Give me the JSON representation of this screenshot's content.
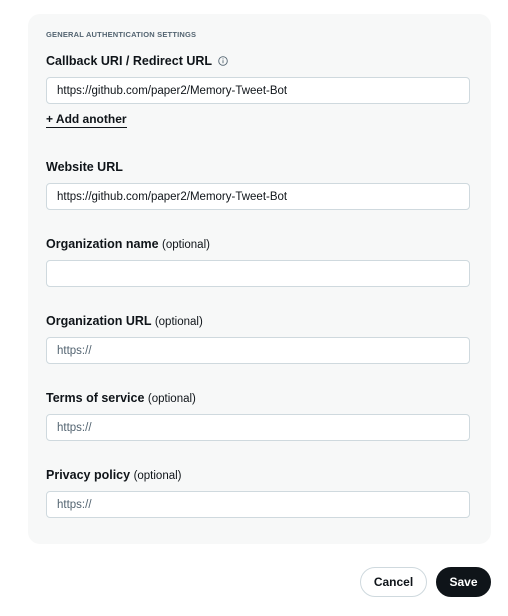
{
  "section": {
    "title": "GENERAL AUTHENTICATION SETTINGS"
  },
  "callback": {
    "label": "Callback URI / Redirect URL",
    "info_icon": "info-circle-icon",
    "value": "https://github.com/paper2/Memory-Tweet-Bot",
    "add_another": "+ Add another"
  },
  "website": {
    "label": "Website URL",
    "value": "https://github.com/paper2/Memory-Tweet-Bot"
  },
  "org_name": {
    "label": "Organization name",
    "optional": "(optional)",
    "value": ""
  },
  "org_url": {
    "label": "Organization URL",
    "optional": "(optional)",
    "placeholder": "https://"
  },
  "terms": {
    "label": "Terms of service",
    "optional": "(optional)",
    "placeholder": "https://"
  },
  "privacy": {
    "label": "Privacy policy",
    "optional": "(optional)",
    "placeholder": "https://"
  },
  "actions": {
    "cancel": "Cancel",
    "save": "Save"
  },
  "colors": {
    "panel_bg": "#f7f8f8",
    "text": "#0f1419",
    "muted": "#536471",
    "border": "#cfd9de",
    "primary_button": "#0f1419"
  }
}
